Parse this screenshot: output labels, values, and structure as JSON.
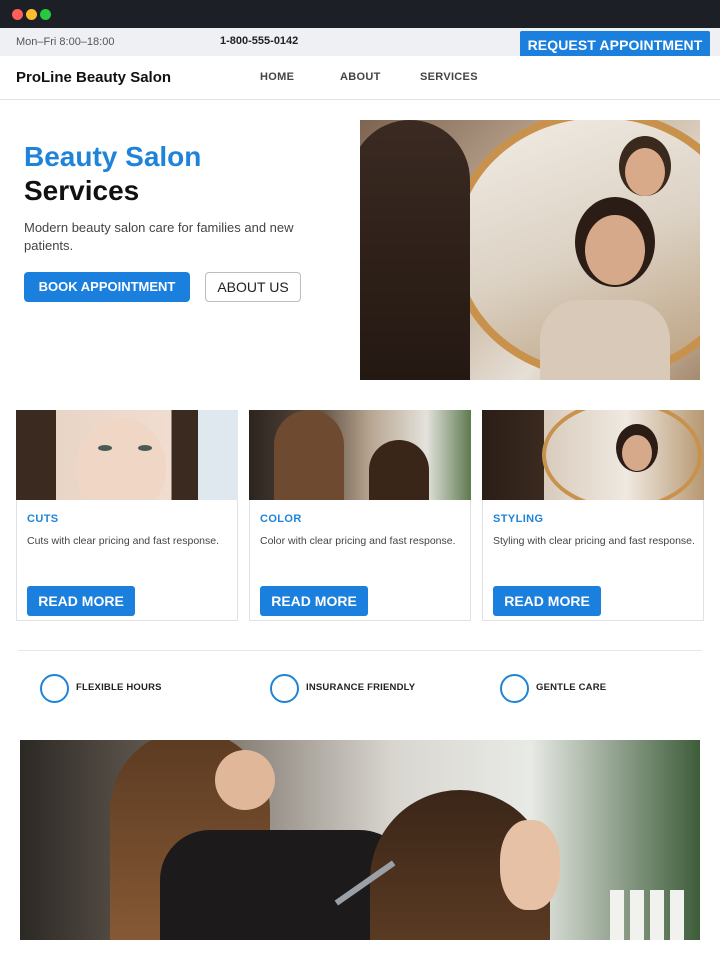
{
  "topbar": {
    "hours": "Mon–Fri 8:00–18:00",
    "phone": "1-800-555-0142",
    "request_label": "REQUEST APPOINTMENT"
  },
  "nav": {
    "brand": "ProLine Beauty Salon",
    "links": [
      "HOME",
      "ABOUT",
      "SERVICES"
    ]
  },
  "hero": {
    "title_accent": "Beauty Salon",
    "title_dark": "Services",
    "description": "Modern beauty salon care for families and new patients.",
    "book_label": "BOOK APPOINTMENT",
    "about_label": "ABOUT US"
  },
  "cards": [
    {
      "title": "CUTS",
      "text": "Cuts with clear pricing and fast response.",
      "button": "READ MORE"
    },
    {
      "title": "COLOR",
      "text": "Color with clear pricing and fast response.",
      "button": "READ MORE"
    },
    {
      "title": "STYLING",
      "text": "Styling with clear pricing and fast response.",
      "button": "READ MORE"
    }
  ],
  "features": [
    "FLEXIBLE HOURS",
    "INSURANCE FRIENDLY",
    "GENTLE CARE"
  ],
  "colors": {
    "accent": "#1f84d9",
    "button": "#1a7fdd",
    "titlebar": "#1c1f26"
  }
}
